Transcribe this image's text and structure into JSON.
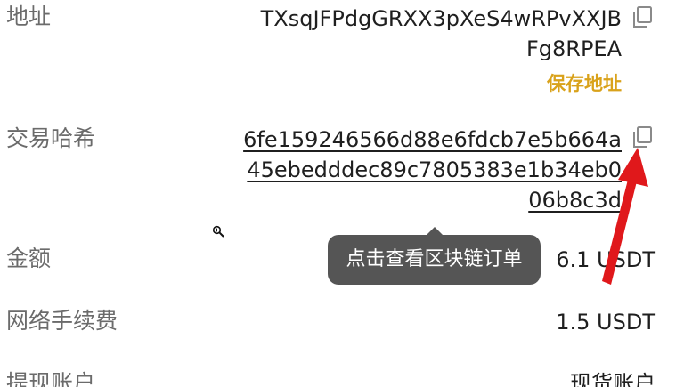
{
  "address": {
    "label": "地址",
    "line1": "TXsqJFPdgGRXX3pXeS4wRPvXXJB",
    "line2": "Fg8RPEA",
    "save_label": "保存地址"
  },
  "tx_hash": {
    "label": "交易哈希",
    "line1": "6fe159246566d88e6fdcb7e5b664a",
    "line2": "45ebedddec89c7805383e1b34eb0",
    "line3": "06b8c3d"
  },
  "tooltip": {
    "text": "点击查看区块链订单"
  },
  "amount": {
    "label": "金额",
    "value": "6.1 USDT"
  },
  "fee": {
    "label": "网络手续费",
    "value": "1.5 USDT"
  },
  "withdraw_account": {
    "label": "提现账户",
    "value": "现货账户"
  },
  "colors": {
    "accent": "#d9a21b",
    "label_gray": "#6b6b6b",
    "tooltip_bg": "#555555",
    "arrow_red": "#e0181b"
  },
  "icons": {
    "copy": "copy-icon",
    "arrow": "red-arrow-annotation"
  }
}
